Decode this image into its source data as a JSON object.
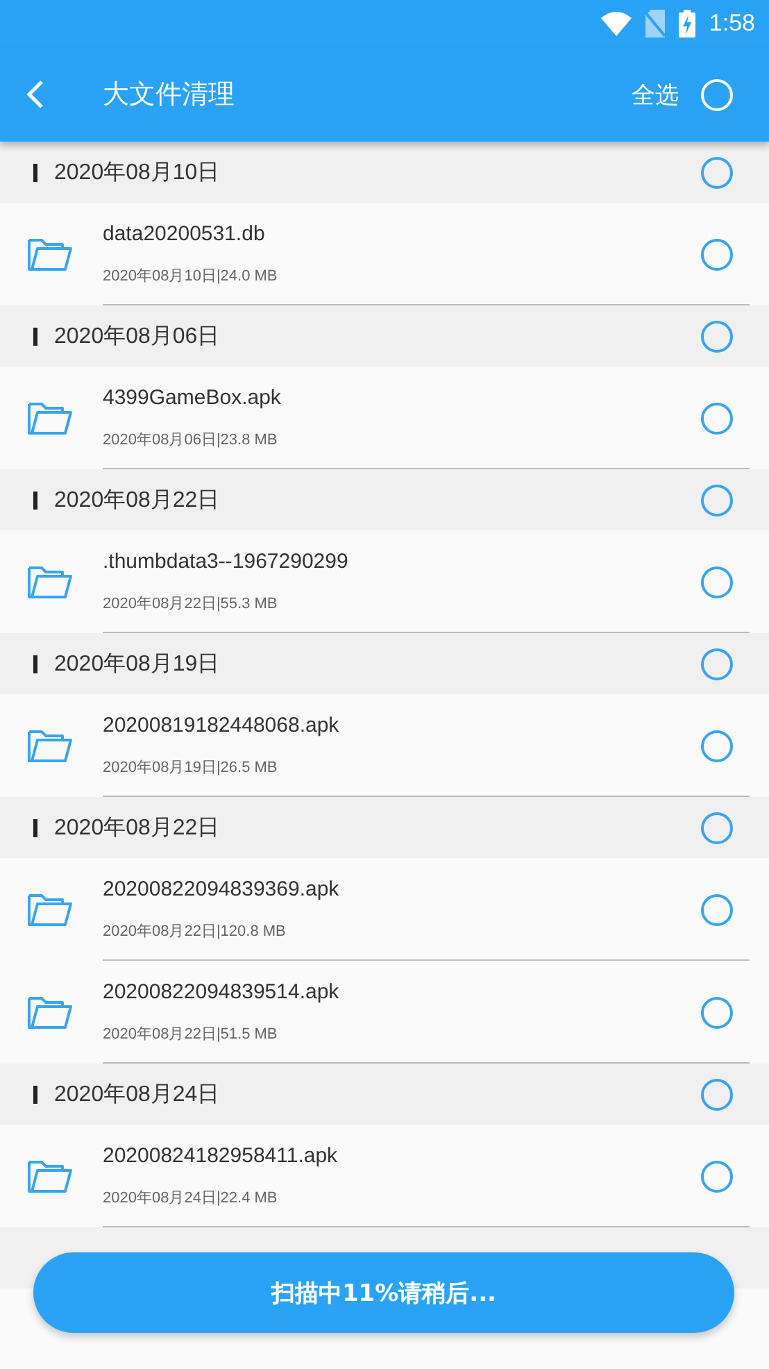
{
  "status_bar": {
    "time": "1:58"
  },
  "toolbar": {
    "title": "大文件清理",
    "select_all": {
      "label": "全选",
      "selected": false
    }
  },
  "sections": [
    {
      "date": "2020年08月10日",
      "selected": false,
      "files": [
        {
          "name": "data20200531.db",
          "meta": "2020年08月10日|24.0 MB",
          "selected": false
        }
      ]
    },
    {
      "date": "2020年08月06日",
      "selected": false,
      "files": [
        {
          "name": "4399GameBox.apk",
          "meta": "2020年08月06日|23.8 MB",
          "selected": false
        }
      ]
    },
    {
      "date": "2020年08月22日",
      "selected": false,
      "files": [
        {
          "name": ".thumbdata3--1967290299",
          "meta": "2020年08月22日|55.3 MB",
          "selected": false
        }
      ]
    },
    {
      "date": "2020年08月19日",
      "selected": false,
      "files": [
        {
          "name": "20200819182448068.apk",
          "meta": "2020年08月19日|26.5 MB",
          "selected": false
        }
      ]
    },
    {
      "date": "2020年08月22日",
      "selected": false,
      "files": [
        {
          "name": "20200822094839369.apk",
          "meta": "2020年08月22日|120.8 MB",
          "selected": false
        },
        {
          "name": "20200822094839514.apk",
          "meta": "2020年08月22日|51.5 MB",
          "selected": false
        }
      ]
    },
    {
      "date": "2020年08月24日",
      "selected": false,
      "files": [
        {
          "name": "20200824182958411.apk",
          "meta": "2020年08月24日|22.4 MB",
          "selected": false
        }
      ]
    }
  ],
  "scan_button": {
    "label": "扫描中11%请稍后..."
  }
}
